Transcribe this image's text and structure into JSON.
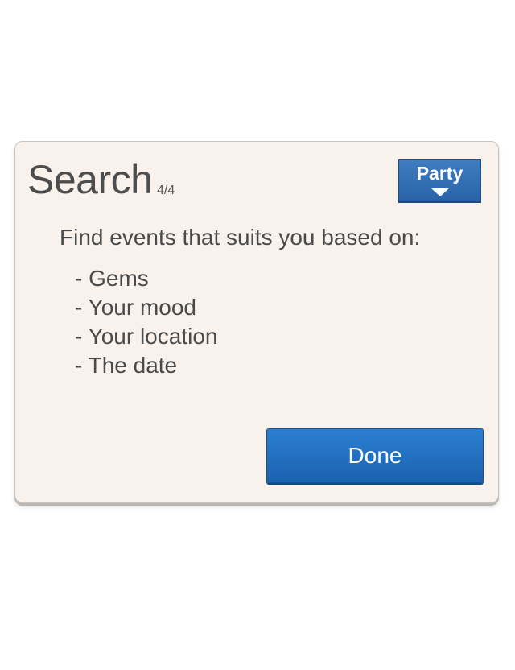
{
  "dialog": {
    "title": "Search",
    "step": "4/4",
    "category_button": {
      "label": "Party",
      "icon": "chevron-down-icon"
    },
    "intro": "Find events that suits you based on:",
    "items": [
      "- Gems",
      "- Your mood",
      "- Your location",
      "- The date"
    ],
    "done_label": "Done"
  },
  "colors": {
    "card_background": "#f8f1ec",
    "accent_blue": "#1f6fc0",
    "text": "#4a4a4a"
  }
}
